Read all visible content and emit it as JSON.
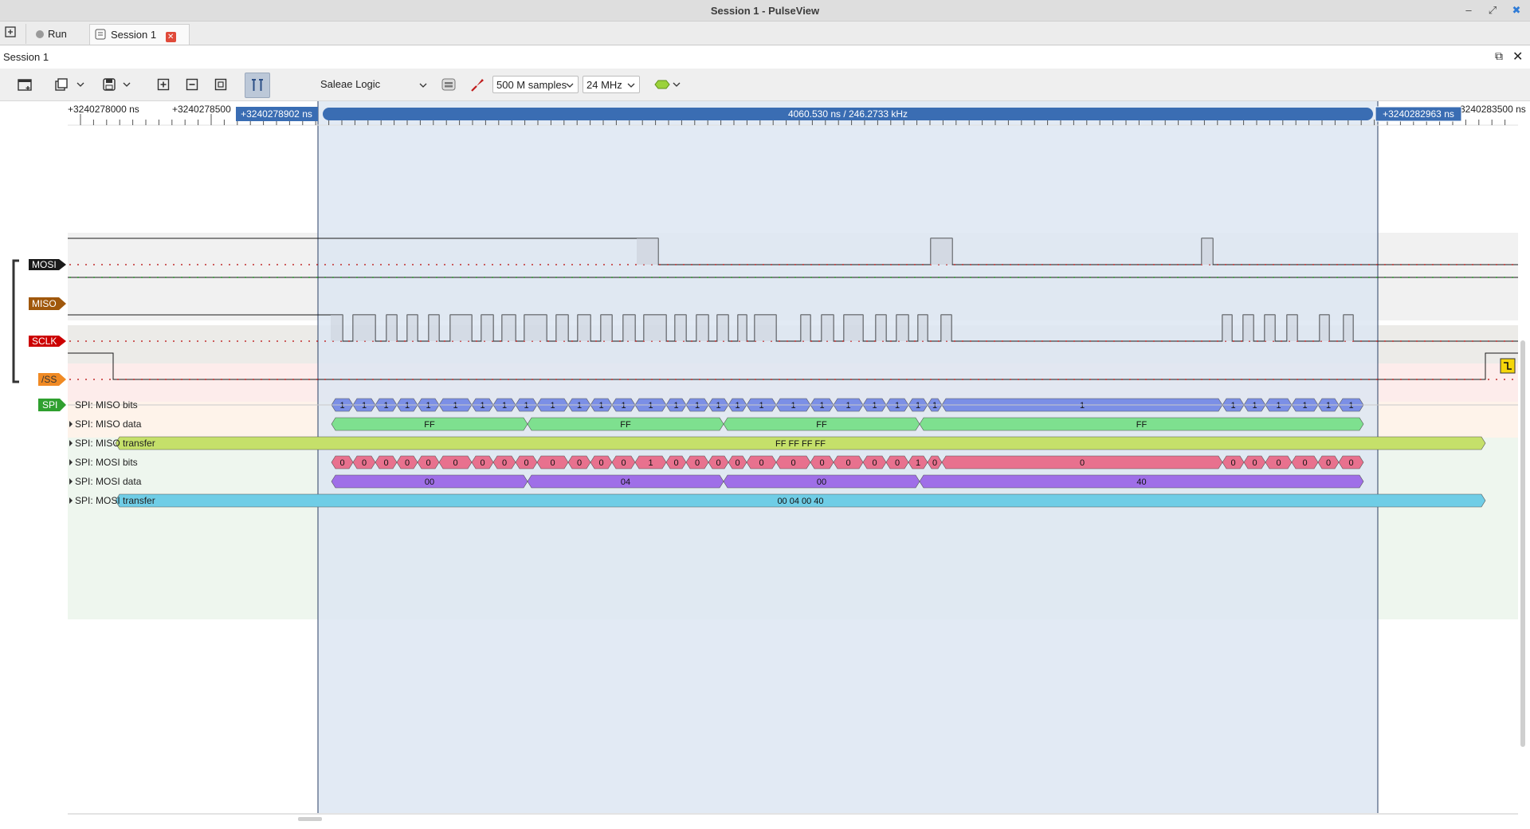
{
  "window": {
    "title": "Session 1 - PulseView"
  },
  "tabs": {
    "run_label": "Run",
    "session_label": "Session 1"
  },
  "session": {
    "header_label": "Session 1"
  },
  "toolbar": {
    "device": "Saleae Logic",
    "samples": "500 M samples",
    "samplerate": "24 MHz"
  },
  "ruler": {
    "ticks": [
      "+3240278000 ns",
      "+3240278500",
      "3240283500 ns"
    ],
    "cursor_left": "+3240278902 ns",
    "cursor_right": "+3240282963 ns",
    "cursor_span": "4060.530 ns / 246.2733 kHz"
  },
  "channels": [
    {
      "name": "MOSI",
      "color": "#1a1a1a"
    },
    {
      "name": "MISO",
      "color": "#a0580c"
    },
    {
      "name": "SCLK",
      "color": "#cc0000"
    },
    {
      "name": "/SS",
      "color": "#f08a24"
    }
  ],
  "decoder": {
    "badge": "SPI",
    "rows": [
      {
        "label": "SPI: MISO bits"
      },
      {
        "label": "SPI: MISO data"
      },
      {
        "label": "SPI: MISO transfer"
      },
      {
        "label": "SPI: MOSI bits"
      },
      {
        "label": "SPI: MOSI data"
      },
      {
        "label": "SPI: MOSI transfer"
      }
    ]
  },
  "annotations": {
    "miso_bits": [
      "1",
      "1",
      "1",
      "1",
      "1",
      "1",
      "1",
      "1",
      "1",
      "1",
      "1",
      "1",
      "1",
      "1",
      "1",
      "1",
      "1",
      "1",
      "1",
      "1",
      "1",
      "1",
      "1",
      "1",
      "1",
      "1",
      "1",
      "1",
      "1",
      "1"
    ],
    "miso_data": [
      "FF",
      "FF",
      "FF",
      "FF"
    ],
    "miso_transfer": "FF FF FF FF",
    "mosi_bits": [
      "0",
      "0",
      "0",
      "0",
      "0",
      "0",
      "0",
      "0",
      "0",
      "0",
      "0",
      "0",
      "0",
      "1",
      "0",
      "0",
      "0",
      "0",
      "0",
      "0",
      "0",
      "0",
      "0",
      "0",
      "1",
      "0",
      "0",
      "0",
      "0",
      "0"
    ],
    "mosi_data": [
      "00",
      "04",
      "00",
      "40"
    ],
    "mosi_transfer": "00 04 00 40"
  },
  "colors": {
    "miso_bits": "#7b8fe6",
    "miso_data": "#7ee08f",
    "miso_transfer": "#c5e06a",
    "mosi_bits": "#e8718e",
    "mosi_data": "#9f6fe8",
    "mosi_transfer": "#6fcde6",
    "selection": "#dde6f2",
    "cursor_bar": "#3a6db3"
  }
}
